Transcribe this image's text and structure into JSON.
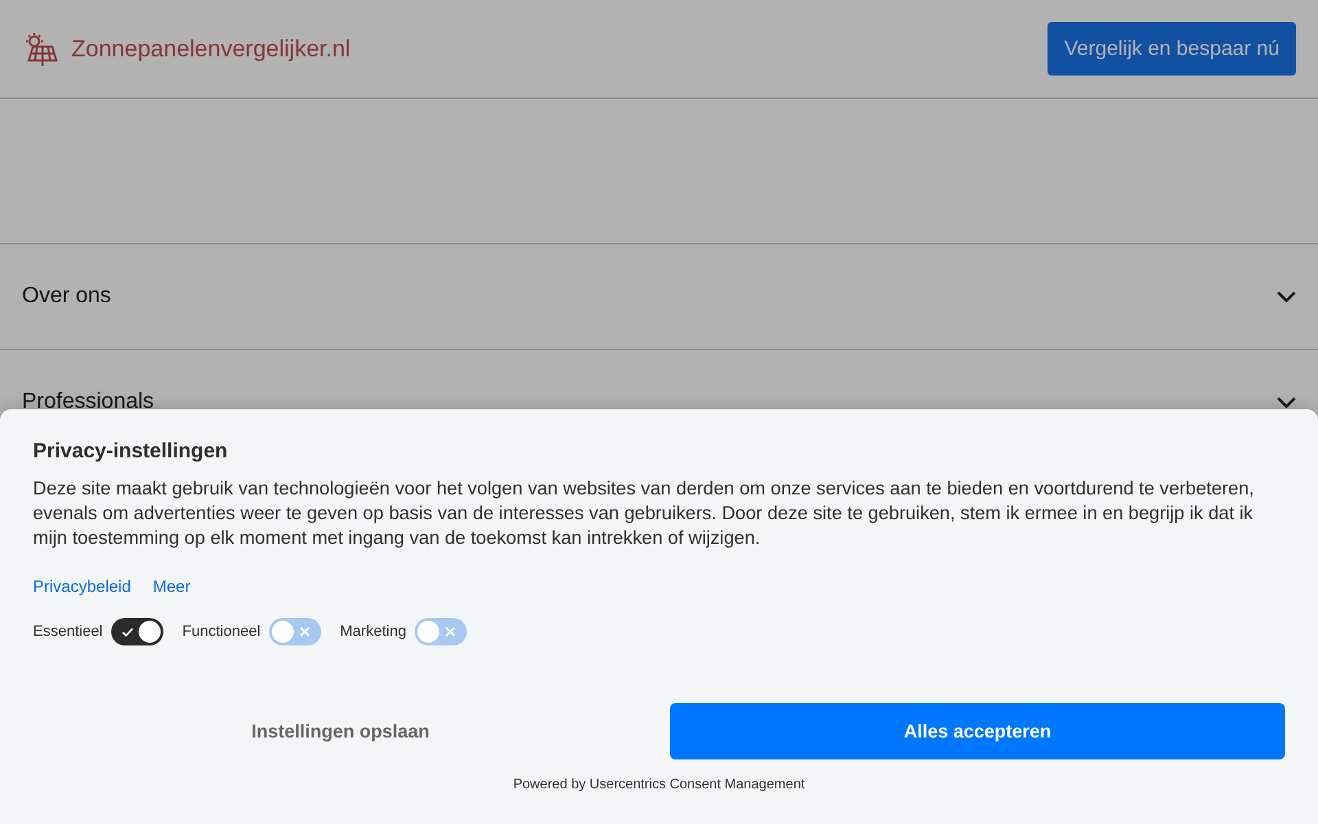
{
  "header": {
    "logo_text": "Zonnepanelenvergelijker.nl",
    "cta_button": "Vergelijk en bespaar nú"
  },
  "accordion": [
    {
      "label": "Over ons",
      "expanded": false
    },
    {
      "label": "Professionals",
      "expanded": false
    }
  ],
  "consent_dialog": {
    "title": "Privacy-instellingen",
    "body": "Deze site maakt gebruik van technologieën voor het volgen van websites van derden om onze services aan te bieden en voortdurend te verbeteren, evenals om advertenties weer te geven op basis van de interesses van gebruikers. Door deze site te gebruiken, stem ik ermee in en begrijp ik dat ik mijn toestemming op elk moment met ingang van de toekomst kan intrekken of wijzigen.",
    "links": [
      "Privacybeleid",
      "Meer"
    ],
    "toggles": [
      {
        "label": "Essentieel",
        "on": true
      },
      {
        "label": "Functioneel",
        "on": false
      },
      {
        "label": "Marketing",
        "on": false
      }
    ],
    "save_button": "Instellingen opslaan",
    "accept_button": "Alles accepteren",
    "footer": "Powered by Usercentrics Consent Management"
  }
}
